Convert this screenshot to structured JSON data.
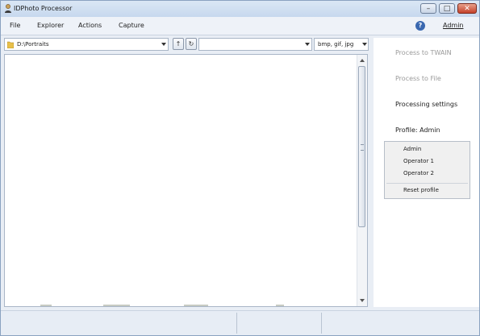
{
  "window": {
    "title": "IDPhoto Processor",
    "controls": {
      "minimize": "–",
      "maximize": "□",
      "close": "✕"
    }
  },
  "menu": {
    "items": [
      "File",
      "Explorer",
      "Actions",
      "Capture"
    ],
    "help_icon": "?",
    "user_label": "Admin"
  },
  "toolbar": {
    "path": "D:\\Portraits",
    "up_label": "↑",
    "refresh_label": "↻",
    "filter_value": "",
    "extensions": "bmp, gif, jpg"
  },
  "side_panel": {
    "process_twain": "Process to TWAIN",
    "process_file": "Process to File",
    "processing_settings": "Processing settings",
    "profile_label": "Profile: Admin",
    "profile_options": [
      "Admin",
      "Operator 1",
      "Operator 2"
    ],
    "reset_profile": "Reset profile"
  },
  "icons": {
    "app": "person-photo-icon",
    "folder": "folder-icon",
    "help": "help-icon"
  },
  "colors": {
    "help_blue": "#3a68b0",
    "disabled_text": "#9a9a9a",
    "close_red": "#c4412a"
  }
}
